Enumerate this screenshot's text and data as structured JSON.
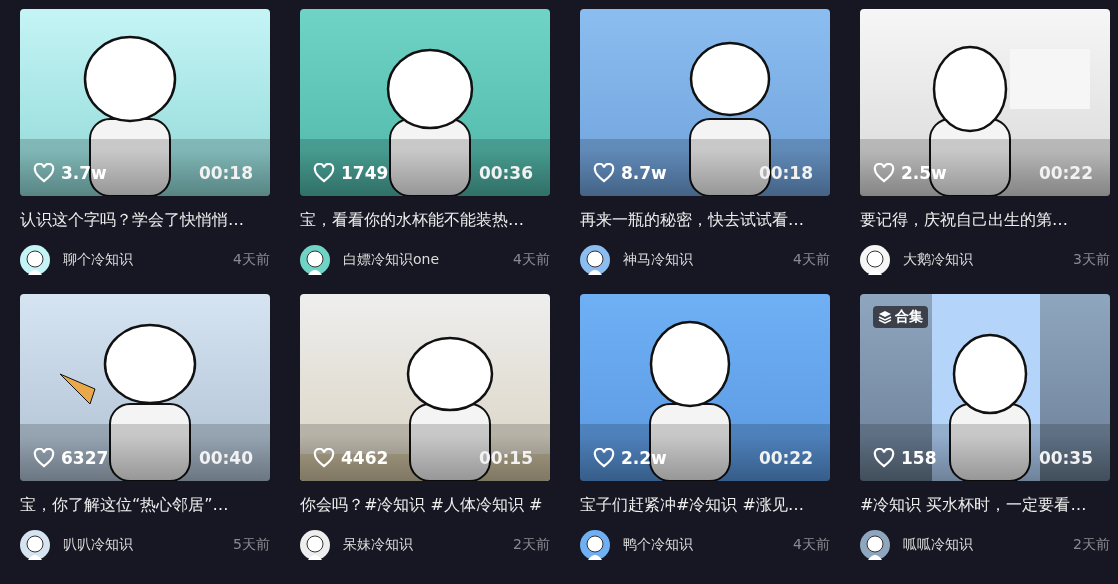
{
  "videos": [
    {
      "likes": "3.7w",
      "duration": "00:18",
      "title": "认识这个字吗？学会了快悄悄…",
      "author": "聊个冷知识",
      "time": "4天前"
    },
    {
      "likes": "1749",
      "duration": "00:36",
      "title": "宝，看看你的水杯能不能装热…",
      "author": "白嫖冷知识one",
      "time": "4天前"
    },
    {
      "likes": "8.7w",
      "duration": "00:18",
      "title": "再来一瓶的秘密，快去试试看…",
      "author": "神马冷知识",
      "time": "4天前"
    },
    {
      "likes": "2.5w",
      "duration": "00:22",
      "title": "要记得，庆祝自己出生的第…",
      "author": "大鹅冷知识",
      "time": "3天前"
    },
    {
      "likes": "6327",
      "duration": "00:40",
      "title": "宝，你了解这位“热心邻居”…",
      "author": "叭叭冷知识",
      "time": "5天前"
    },
    {
      "likes": "4462",
      "duration": "00:15",
      "title": "你会吗？#冷知识 #人体冷知识 #",
      "author": "呆妹冷知识",
      "time": "2天前"
    },
    {
      "likes": "2.2w",
      "duration": "00:22",
      "title": "宝子们赶紧冲#冷知识 #涨见…",
      "author": "鸭个冷知识",
      "time": "4天前"
    },
    {
      "likes": "158",
      "duration": "00:35",
      "title": "#冷知识 买水杯时，一定要看…",
      "author": "呱呱冷知识",
      "time": "2天前",
      "badge": "合集"
    }
  ]
}
